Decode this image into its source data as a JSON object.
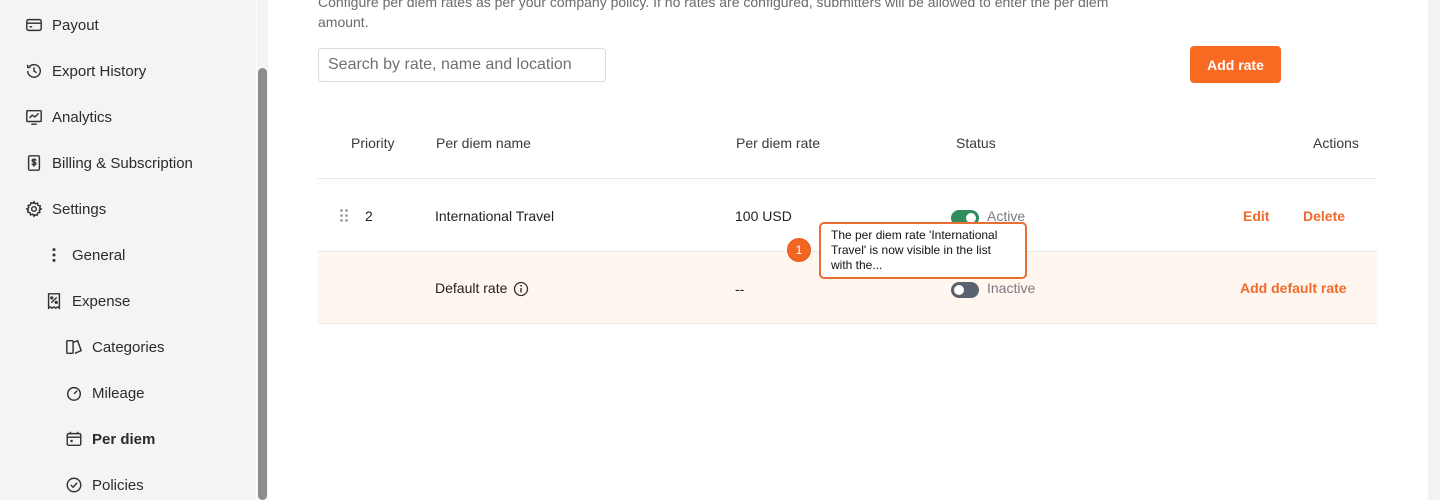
{
  "sidebar": {
    "items": [
      {
        "label": "Payout",
        "icon": "payout-icon"
      },
      {
        "label": "Export History",
        "icon": "history-icon"
      },
      {
        "label": "Analytics",
        "icon": "analytics-icon"
      },
      {
        "label": "Billing & Subscription",
        "icon": "billing-icon"
      },
      {
        "label": "Settings",
        "icon": "gear-icon"
      },
      {
        "label": "General",
        "icon": "more-vertical-icon"
      },
      {
        "label": "Expense",
        "icon": "expense-icon"
      },
      {
        "label": "Categories",
        "icon": "categories-icon"
      },
      {
        "label": "Mileage",
        "icon": "speedometer-icon"
      },
      {
        "label": "Per diem",
        "icon": "calendar-icon",
        "active": true
      },
      {
        "label": "Policies",
        "icon": "check-circle-icon"
      }
    ]
  },
  "main": {
    "description": "Configure per diem rates as per your company policy. If no rates are configured, submitters will be allowed to enter the per diem amount.",
    "search_placeholder": "Search by rate, name and location",
    "add_button": "Add rate",
    "table": {
      "headers": {
        "priority": "Priority",
        "name": "Per diem name",
        "rate": "Per diem rate",
        "status": "Status",
        "actions": "Actions"
      },
      "rows": [
        {
          "priority": "2",
          "name": "International Travel",
          "rate": "100 USD",
          "status": "Active",
          "active": true,
          "edit": "Edit",
          "delete": "Delete"
        }
      ],
      "default_row": {
        "name": "Default rate",
        "rate": "--",
        "status": "Inactive",
        "active": false,
        "action": "Add default rate"
      }
    }
  },
  "annotation": {
    "number": "1",
    "text": "The per diem rate 'International Travel' is now visible in the list with the..."
  },
  "colors": {
    "accent": "#f86a22",
    "toggle_on": "#2f8c5d",
    "toggle_off": "#5a6170",
    "default_row_bg": "#fff6f0"
  }
}
